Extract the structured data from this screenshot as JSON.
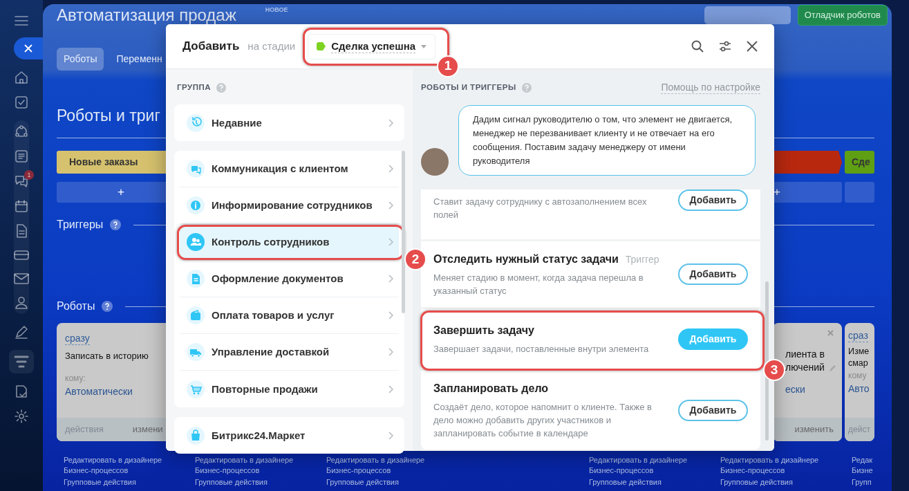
{
  "sidebar": {
    "chat_badge": "1"
  },
  "page": {
    "title": "Автоматизация продаж",
    "new_label": "НОВОЕ",
    "debugger_button": "Отладчик роботов",
    "tabs": [
      {
        "label": "Роботы",
        "selected": true
      },
      {
        "label": "Переменн",
        "selected": false
      }
    ],
    "section_title": "Роботы и триг",
    "triggers_label": "Триггеры",
    "robots_label": "Роботы",
    "columns": [
      {
        "stage": {
          "label": "Новые заказы",
          "color": "#d6c26e"
        },
        "add": "+",
        "card": {
          "delay": "сразу",
          "title_lines": [
            "Записать в историю"
          ],
          "to_label": "кому:",
          "to_value": "Автоматически",
          "actions": "действия",
          "edit": "измени"
        },
        "footer": {
          "link": "Редактировать в дизайнере Бизнес-процессов",
          "group": "Групповые действия"
        }
      },
      {
        "footer": {
          "link": "Редактировать в дизайнере Бизнес-процессов",
          "group": "Групповые действия"
        }
      },
      {
        "footer": {
          "link": "Редактировать в дизайнере Бизнес-процессов",
          "group": "Групповые действия"
        }
      },
      {},
      {
        "footer": {
          "link": "Редактировать в дизайнере Бизнес-процессов",
          "group": "Групповые действия"
        }
      },
      {
        "stage": {
          "color": "#b8280f"
        },
        "add": "+",
        "card": {
          "title_lines": [
            "лиента в",
            "лючений"
          ],
          "to_value": "ески",
          "edit": "изменить",
          "closable": true
        },
        "footer": {
          "link": "Редактировать в дизайнере Бизнес-процессов",
          "group": "Групповые действия"
        }
      },
      {
        "stage": {
          "label": "Сде",
          "color": "#5f9f14"
        },
        "card": {
          "delay": "сраз",
          "title_lines": [
            "Изме",
            "смар"
          ],
          "to_label": "кому",
          "to_value": "Авто",
          "actions": "дейст"
        },
        "footer": {
          "link": "Редак Бизне",
          "group": "Групп"
        }
      }
    ]
  },
  "modal": {
    "title": "Добавить",
    "stage_prefix": "на стадии",
    "stage": {
      "label": "Сделка успешна",
      "color": "#7ed321",
      "callout": "1"
    },
    "groups_header": "ГРУППА",
    "groups": [
      {
        "label": "Недавние",
        "kind": "single",
        "selected": false
      },
      {
        "label": "Коммуникация с клиентом",
        "kind": "list",
        "selected": false
      },
      {
        "label": "Информирование сотрудников",
        "kind": "list",
        "selected": false
      },
      {
        "label": "Контроль сотрудников",
        "kind": "list",
        "selected": true,
        "callout": "2"
      },
      {
        "label": "Оформление документов",
        "kind": "list",
        "selected": false
      },
      {
        "label": "Оплата товаров и услуг",
        "kind": "list",
        "selected": false
      },
      {
        "label": "Управление доставкой",
        "kind": "list",
        "selected": false
      },
      {
        "label": "Повторные продажи",
        "kind": "list",
        "selected": false
      },
      {
        "label": "Битрикс24.Маркет",
        "kind": "single",
        "selected": false
      }
    ],
    "robots_header": "РОБОТЫ И ТРИГГЕРЫ",
    "help_link": "Помощь по настройке",
    "hint": "Дадим сигнал руководителю о том, что элемент не двигается, менеджер не перезванивает клиенту и не отвечает на его сообщения. Поставим задачу менеджеру от имени руководителя",
    "robots": [
      {
        "description": "Ставит задачу сотруднику с автозаполнением всех полей",
        "button": "Добавить",
        "highlighted": false
      },
      {
        "title": "Отследить нужный статус задачи",
        "tag": "Триггер",
        "description": "Меняет стадию в момент, когда задача перешла в указанный статус",
        "button": "Добавить",
        "highlighted": false
      },
      {
        "title": "Завершить задачу",
        "description": "Завершает задачи, поставленные внутри элемента",
        "button": "Добавить",
        "highlighted": true,
        "callout": "3"
      },
      {
        "title": "Запланировать дело",
        "description": "Создаёт дело, которое напомнит о клиенте. Также в дело можно добавить других участников и запланировать событие в календаре",
        "button": "Добавить",
        "highlighted": false
      }
    ]
  }
}
